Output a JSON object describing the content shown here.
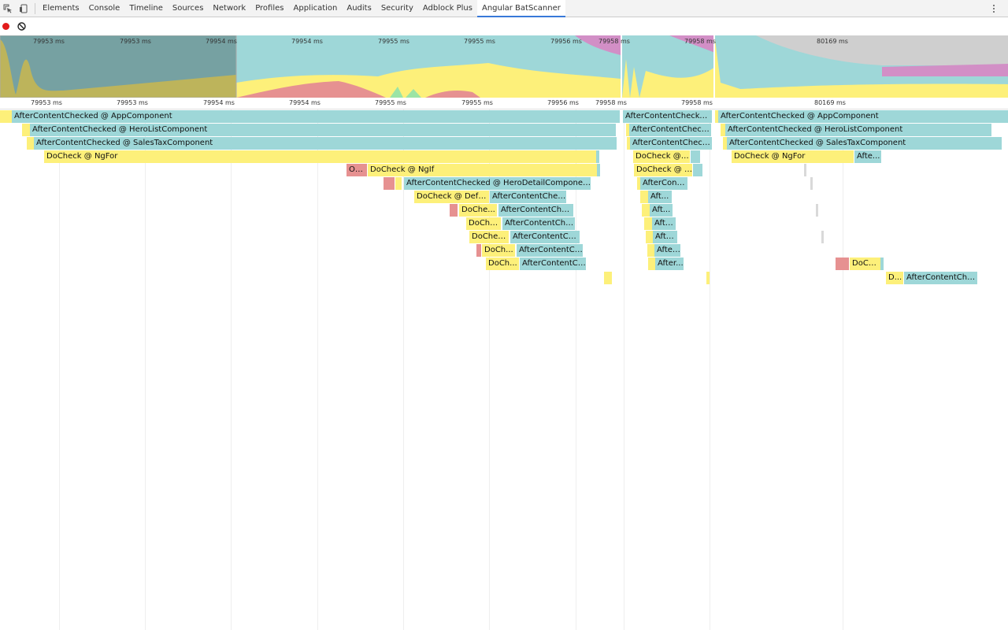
{
  "tabs": [
    {
      "label": "Elements"
    },
    {
      "label": "Console"
    },
    {
      "label": "Timeline"
    },
    {
      "label": "Sources"
    },
    {
      "label": "Network"
    },
    {
      "label": "Profiles"
    },
    {
      "label": "Application"
    },
    {
      "label": "Audits"
    },
    {
      "label": "Security"
    },
    {
      "label": "Adblock Plus"
    },
    {
      "label": "Angular BatScanner"
    }
  ],
  "selected_tab": "Angular BatScanner",
  "colors": {
    "afterContentChecked": "#9ed7d8",
    "doCheck": "#fdf07a",
    "onChanges": "#e69191",
    "other": "#9be4a5",
    "record": "#e21c1c",
    "tab_accent": "#3879d9"
  },
  "overview_ticks": [
    "79953 ms",
    "79953 ms",
    "79954 ms",
    "79954 ms",
    "79955 ms",
    "79955 ms",
    "79956 ms",
    "79958 ms",
    "79958 ms",
    "80169 ms"
  ],
  "ruler_ticks": [
    "79953 ms",
    "79953 ms",
    "79954 ms",
    "79954 ms",
    "79955 ms",
    "79955 ms",
    "79956 ms",
    "79958 ms",
    "79958 ms",
    "80169 ms"
  ],
  "flame": {
    "left": [
      "AfterContentChecked @ AppComponent",
      "AfterContentChecked @ HeroListComponent",
      "AfterContentChecked @ SalesTaxComponent",
      "DoCheck @ NgFor",
      "On...",
      "DoCheck @ NgIf",
      "AfterContentChecked @ HeroDetailComponent",
      "DoCheck @ Defau...",
      "AfterContentCheck...",
      "DoChe...",
      "AfterContentChec...",
      "DoChe...",
      "AfterContentChec...",
      "DoChec...",
      "AfterContentChe...",
      "DoCh...",
      "AfterContentCh...",
      "DoCh...",
      "AfterContentCh..."
    ],
    "middle": [
      "AfterContentChecked ...",
      "AfterContentChecke...",
      "AfterContentChecke...",
      "DoCheck @ ...",
      "DoCheck @ N...",
      "AfterConte...",
      "Aft...",
      "Aft...",
      "Afte...",
      "Afte...",
      "After...",
      "After..."
    ],
    "right": [
      "AfterContentChecked @ AppComponent",
      "AfterContentChecked @ HeroListComponent",
      "AfterContentChecked @ SalesTaxComponent",
      "DoCheck @ NgFor",
      "Afte...",
      "DoCh...",
      "D...",
      "AfterContentChec..."
    ]
  }
}
